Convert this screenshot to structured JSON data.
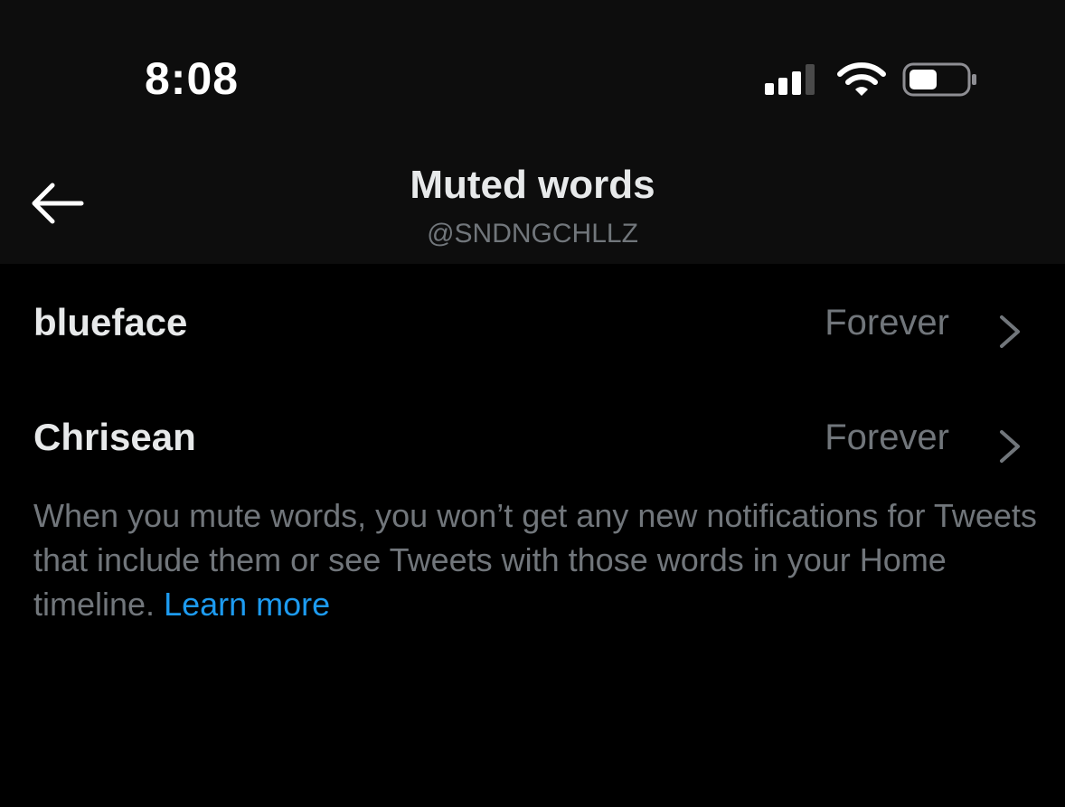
{
  "status_bar": {
    "time": "8:08",
    "icons": [
      "cellular-signal-icon",
      "wifi-icon",
      "battery-icon"
    ]
  },
  "nav": {
    "back_icon": "arrow-left-icon",
    "title": "Muted words",
    "subtitle": "@SNDNGCHLLZ"
  },
  "muted_words": [
    {
      "word": "blueface",
      "duration": "Forever",
      "icon": "chevron-right-icon"
    },
    {
      "word": "Chrisean",
      "duration": "Forever",
      "icon": "chevron-right-icon"
    }
  ],
  "info": {
    "text": "When you mute words, you won’t get any new notifications for Tweets that include them or see Tweets with those words in your Home timeline. ",
    "link": "Learn more"
  },
  "colors": {
    "background": "#000000",
    "header_background": "#0d0d0d",
    "primary_text": "#e7e9ea",
    "secondary_text": "#71767b",
    "link": "#1d9bf0"
  }
}
